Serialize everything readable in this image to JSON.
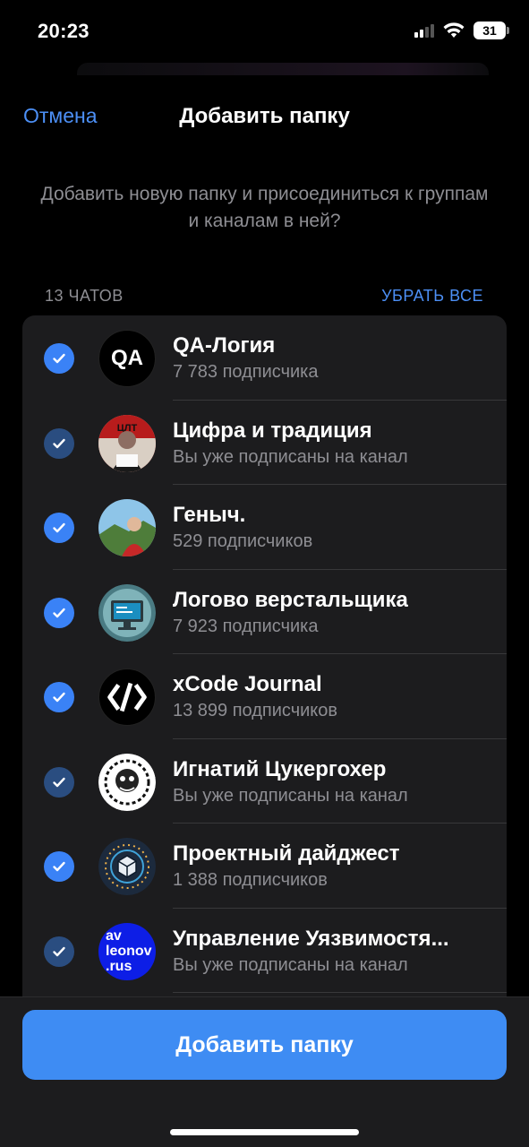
{
  "status_bar": {
    "time": "20:23",
    "battery": "31"
  },
  "nav": {
    "cancel_label": "Отмена",
    "title": "Добавить папку"
  },
  "description": "Добавить новую папку и присоединиться к группам и каналам в ней?",
  "section": {
    "count_label": "13 ЧАТОВ",
    "remove_all_label": "УБРАТЬ ВСЕ"
  },
  "chats": [
    {
      "title": "QA-Логия",
      "subtitle": "7 783 подписчика",
      "avatar_text": "QA",
      "checked": true
    },
    {
      "title": "Цифра и традиция",
      "subtitle": "Вы уже подписаны на канал",
      "avatar_text": "ЦЛТ",
      "checked": true
    },
    {
      "title": "Геныч.",
      "subtitle": "529 подписчиков",
      "checked": true
    },
    {
      "title": "Логово верстальщика",
      "subtitle": "7 923 подписчика",
      "checked": true
    },
    {
      "title": "xCode Journal",
      "subtitle": "13 899 подписчиков",
      "checked": true
    },
    {
      "title": "Игнатий Цукергохер",
      "subtitle": "Вы уже подписаны на канал",
      "checked": true
    },
    {
      "title": "Проектный дайджест",
      "subtitle": "1 388 подписчиков",
      "checked": true
    },
    {
      "title": "Управление Уязвимостя...",
      "subtitle": "Вы уже подписаны на канал",
      "avatar_lines": [
        "av",
        "leonov",
        ".rus"
      ],
      "checked": true
    }
  ],
  "add_button_label": "Добавить папку",
  "colors": {
    "accent": "#3e8cf3",
    "link": "#4c8ff5",
    "background": "#000000",
    "card": "#1c1c1e",
    "secondary_text": "#8e8e93"
  }
}
